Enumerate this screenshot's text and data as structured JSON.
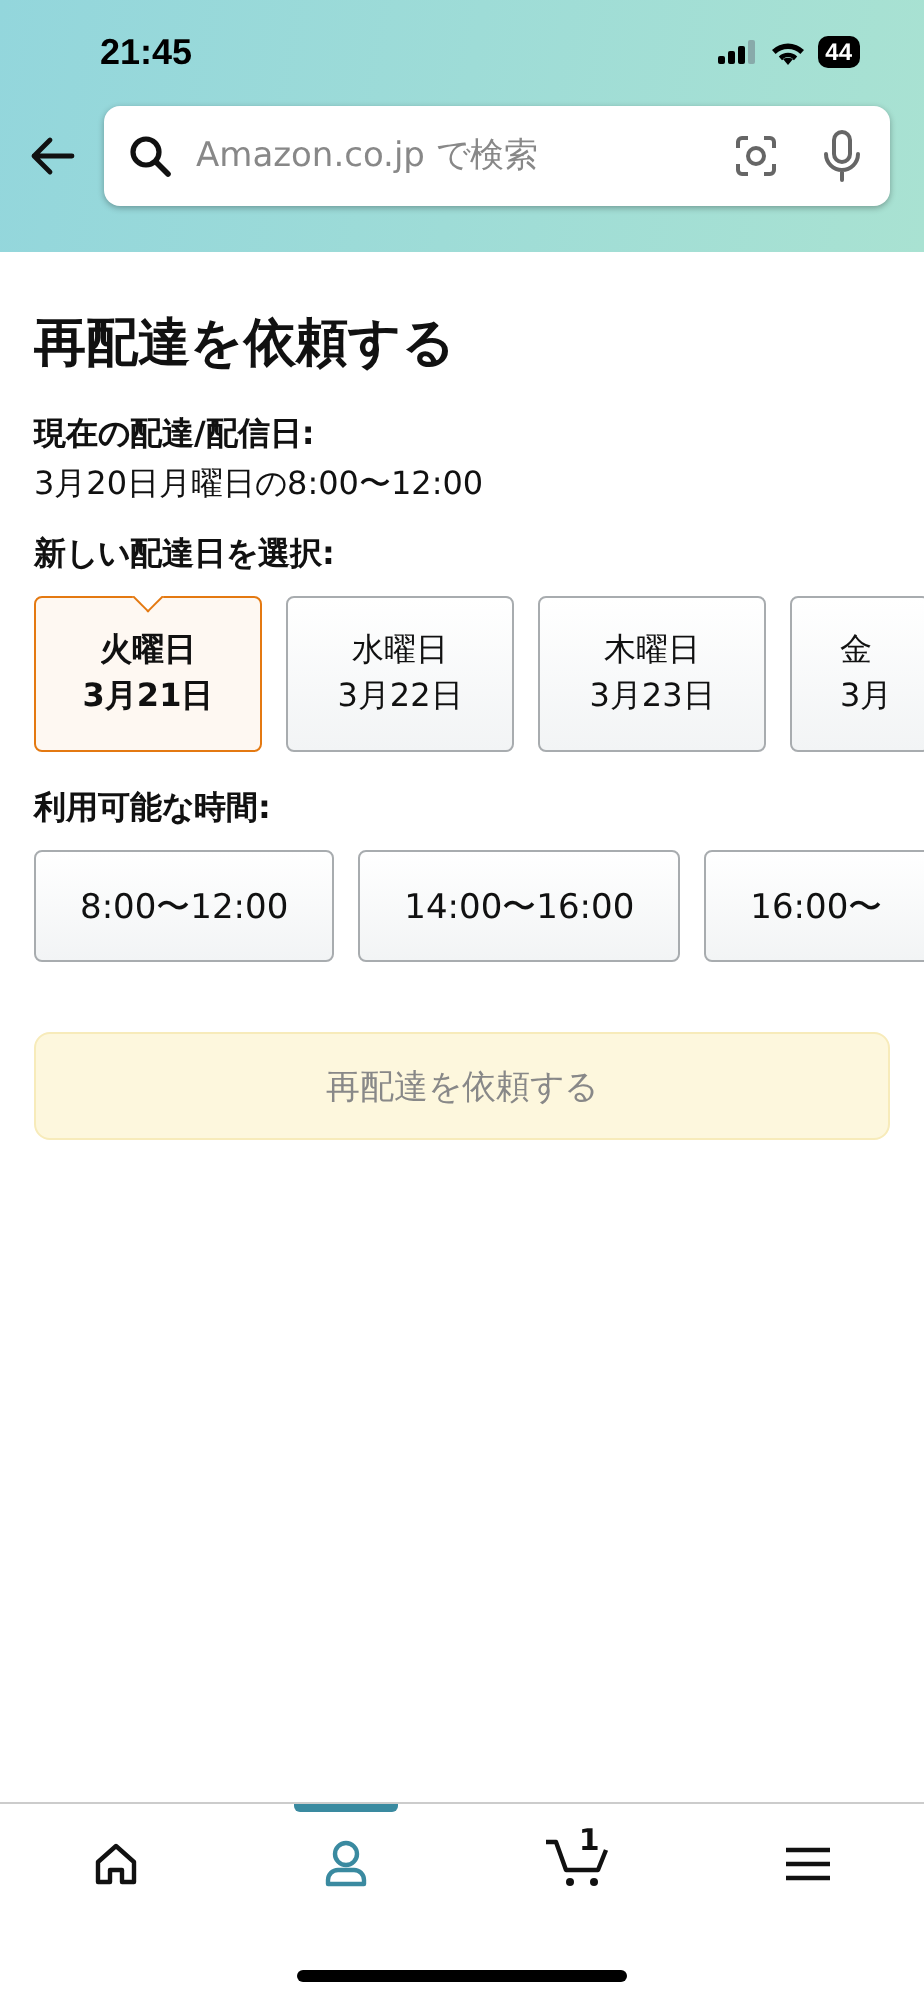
{
  "status_bar": {
    "time": "21:45",
    "battery": "44"
  },
  "search": {
    "placeholder": "Amazon.co.jp で検索"
  },
  "title": "再配達を依頼する",
  "current": {
    "label": "現在の配達/配信日:",
    "value": "3月20日月曜日の8:00〜12:00"
  },
  "date_section": {
    "label": "新しい配達日を選択:"
  },
  "dates": [
    {
      "day": "火曜日",
      "date": "3月21日",
      "selected": true
    },
    {
      "day": "水曜日",
      "date": "3月22日",
      "selected": false
    },
    {
      "day": "木曜日",
      "date": "3月23日",
      "selected": false
    },
    {
      "day": "金",
      "date": "3月",
      "selected": false
    }
  ],
  "time_section": {
    "label": "利用可能な時間:"
  },
  "times": [
    {
      "label": "8:00〜12:00",
      "selected": false
    },
    {
      "label": "14:00〜16:00",
      "selected": false
    },
    {
      "label": "16:00〜",
      "selected": false
    }
  ],
  "submit": {
    "label": "再配達を依頼する",
    "disabled": true
  },
  "tab_bar": [
    {
      "kind": "home",
      "selected": false
    },
    {
      "kind": "account",
      "selected": true
    },
    {
      "kind": "cart",
      "count": "1",
      "selected": false
    },
    {
      "kind": "menu",
      "selected": false
    }
  ]
}
